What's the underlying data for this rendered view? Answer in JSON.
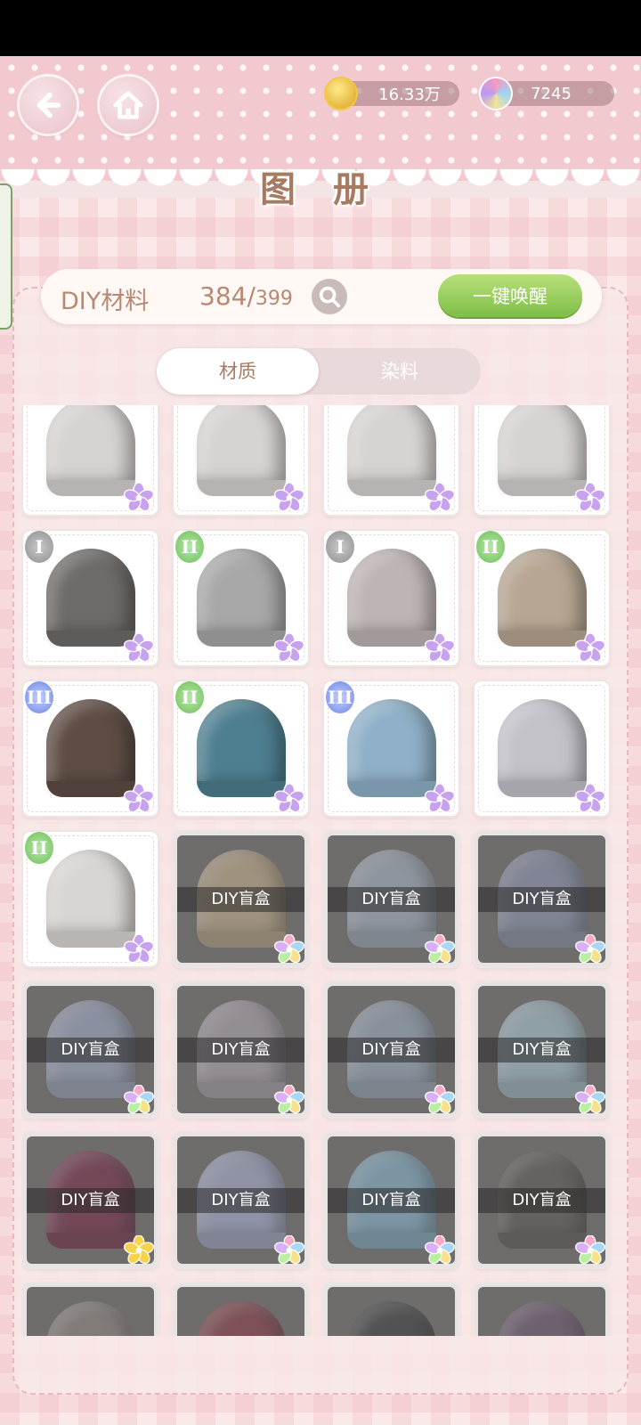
{
  "header": {
    "title": "图 册",
    "currency": [
      {
        "icon": "gold-coin-icon",
        "value": "16.33万"
      },
      {
        "icon": "diamond-gem-icon",
        "value": "7245"
      }
    ]
  },
  "info": {
    "label": "DIY材料",
    "collected": "384/",
    "total": "399",
    "awaken_label": "一键唤醒"
  },
  "tabs": [
    {
      "label": "材质",
      "active": true
    },
    {
      "label": "染料",
      "active": false
    }
  ],
  "locked_label": "DIY盲盒",
  "colors": {
    "accent_text": "#a77a62",
    "button_green": "#7fbe47",
    "header_pink": "#f1c9cf"
  },
  "tiles": [
    {
      "locked": false,
      "tier": "",
      "color": "#d7d3d3",
      "flower": "purple"
    },
    {
      "locked": false,
      "tier": "",
      "color": "#d7d3d3",
      "flower": "purple"
    },
    {
      "locked": false,
      "tier": "",
      "color": "#d7d3d3",
      "flower": "purple"
    },
    {
      "locked": false,
      "tier": "",
      "color": "#d7d3d3",
      "flower": "purple"
    },
    {
      "locked": false,
      "tier": "I",
      "color": "#6e6b68",
      "flower": "purple"
    },
    {
      "locked": false,
      "tier": "II",
      "color": "#a8a8a8",
      "flower": "purple"
    },
    {
      "locked": false,
      "tier": "I",
      "color": "#bdb4b5",
      "flower": "purple"
    },
    {
      "locked": false,
      "tier": "II",
      "color": "#b7a693",
      "flower": "purple"
    },
    {
      "locked": false,
      "tier": "III",
      "color": "#5e4d44",
      "flower": "purple"
    },
    {
      "locked": false,
      "tier": "II",
      "color": "#4e7f90",
      "flower": "purple"
    },
    {
      "locked": false,
      "tier": "III",
      "color": "#8fb0c8",
      "flower": "purple"
    },
    {
      "locked": false,
      "tier": "",
      "color": "#c3c2c9",
      "flower": "purple"
    },
    {
      "locked": false,
      "tier": "II",
      "color": "#d8d5d2",
      "flower": "purple"
    },
    {
      "locked": true,
      "tier": "",
      "color": "#c7b28f",
      "flower": "rainbow"
    },
    {
      "locked": true,
      "tier": "",
      "color": "#a8b8c6",
      "flower": "rainbow"
    },
    {
      "locked": true,
      "tier": "",
      "color": "#8e9ab6",
      "flower": "rainbow"
    },
    {
      "locked": true,
      "tier": "",
      "color": "#a3aecb",
      "flower": "rainbow"
    },
    {
      "locked": true,
      "tier": "",
      "color": "#b2aab6",
      "flower": "rainbow"
    },
    {
      "locked": true,
      "tier": "",
      "color": "#9eb1c4",
      "flower": "rainbow"
    },
    {
      "locked": true,
      "tier": "",
      "color": "#a9c9d6",
      "flower": "rainbow"
    },
    {
      "locked": true,
      "tier": "",
      "color": "#7a2c4a",
      "flower": "gold"
    },
    {
      "locked": true,
      "tier": "",
      "color": "#a9b4d6",
      "flower": "rainbow"
    },
    {
      "locked": true,
      "tier": "",
      "color": "#85b9d2",
      "flower": "rainbow"
    },
    {
      "locked": true,
      "tier": "",
      "color": "#5d5b58",
      "flower": "rainbow"
    },
    {
      "locked": true,
      "tier": "",
      "color": "#8f8a83",
      "flower": "rainbow"
    },
    {
      "locked": true,
      "tier": "",
      "color": "#8a3d48",
      "flower": "rainbow"
    },
    {
      "locked": true,
      "tier": "",
      "color": "#3c3f41",
      "flower": "rainbow"
    },
    {
      "locked": true,
      "tier": "",
      "color": "#6e5a73",
      "flower": "rainbow"
    }
  ]
}
